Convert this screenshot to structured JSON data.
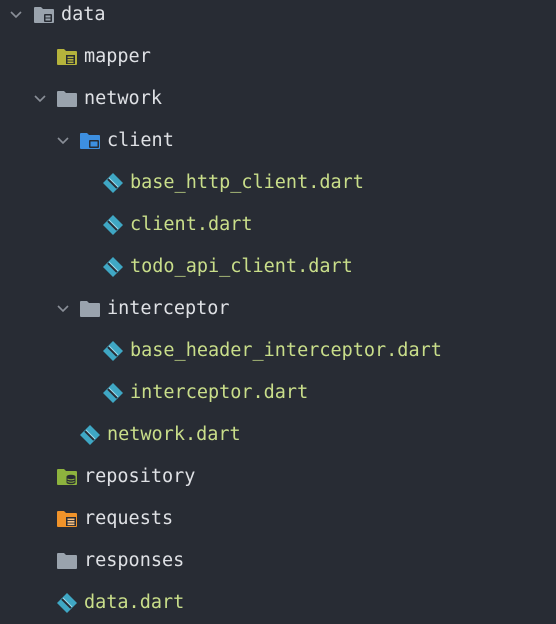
{
  "colors": {
    "background": "#282c34",
    "folder_text": "#dfe1e5",
    "dart_file_text": "#c9de8a",
    "folder_gray": "#9aa3ad",
    "folder_olive": "#b5b33c",
    "folder_blue": "#3d8fe0",
    "folder_green": "#8db33e",
    "folder_orange": "#f0932a",
    "dart_icon": "#3fa7c4",
    "chevron": "#8a8f98"
  },
  "tree": {
    "root": {
      "label": "data",
      "icon": "folder-database-icon",
      "expanded": true
    },
    "mapper": {
      "label": "mapper",
      "icon": "folder-mapper-icon"
    },
    "network": {
      "label": "network",
      "icon": "folder-icon",
      "expanded": true
    },
    "client": {
      "label": "client",
      "icon": "folder-client-icon",
      "expanded": true
    },
    "base_http_client": {
      "label": "base_http_client.dart",
      "icon": "dart-file-icon"
    },
    "client_dart": {
      "label": "client.dart",
      "icon": "dart-file-icon"
    },
    "todo_api_client": {
      "label": "todo_api_client.dart",
      "icon": "dart-file-icon"
    },
    "interceptor": {
      "label": "interceptor",
      "icon": "folder-icon",
      "expanded": true
    },
    "base_header_interceptor": {
      "label": "base_header_interceptor.dart",
      "icon": "dart-file-icon"
    },
    "interceptor_dart": {
      "label": "interceptor.dart",
      "icon": "dart-file-icon"
    },
    "network_dart": {
      "label": "network.dart",
      "icon": "dart-file-icon"
    },
    "repository": {
      "label": "repository",
      "icon": "folder-repository-icon"
    },
    "requests": {
      "label": "requests",
      "icon": "folder-requests-icon"
    },
    "responses": {
      "label": "responses",
      "icon": "folder-icon"
    },
    "data_dart": {
      "label": "data.dart",
      "icon": "dart-file-icon"
    }
  }
}
